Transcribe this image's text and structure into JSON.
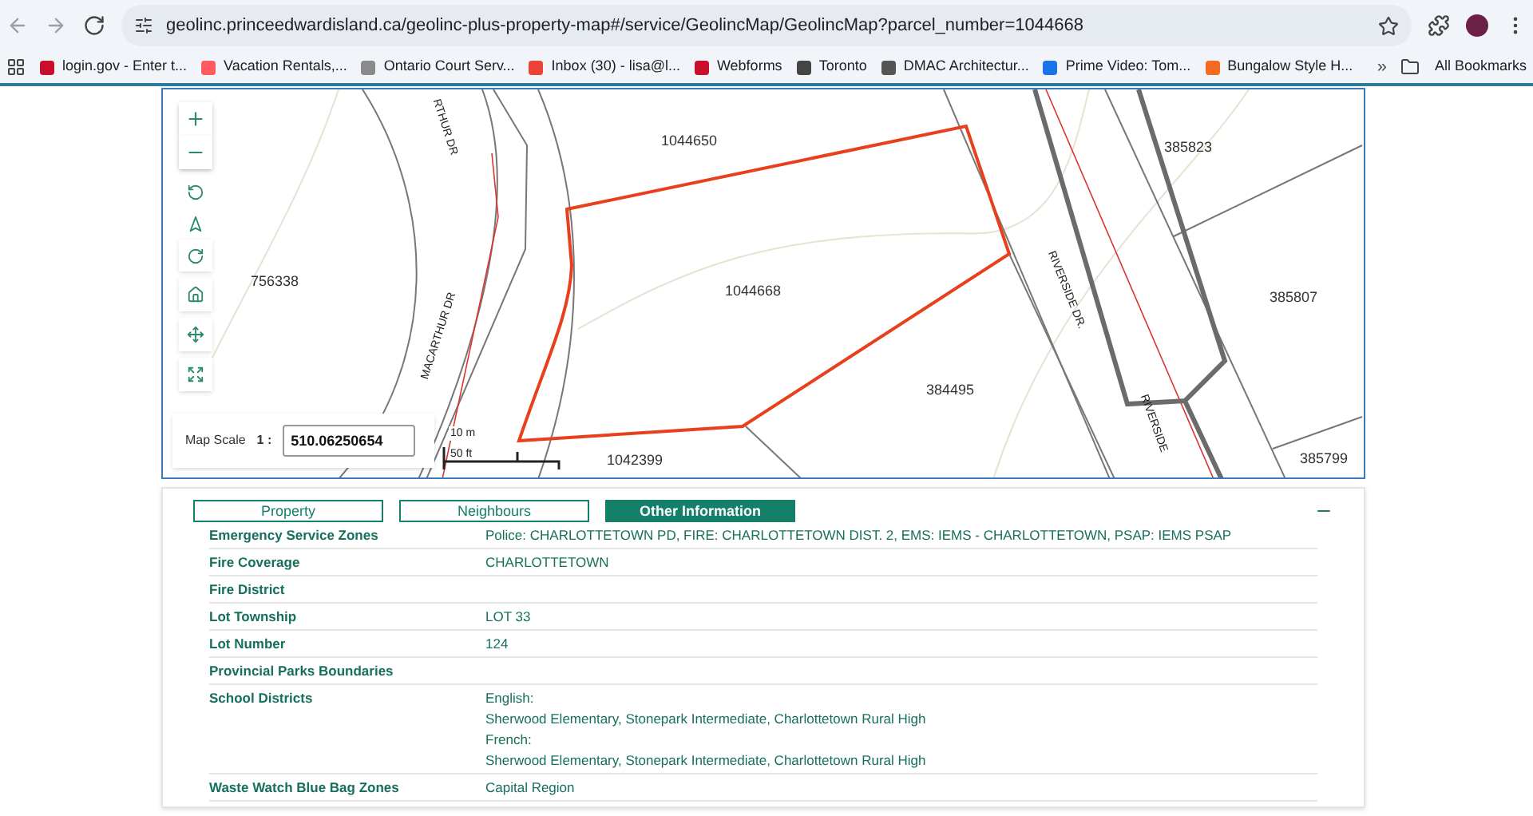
{
  "browser": {
    "url": "geolinc.princeedwardisland.ca/geolinc-plus-property-map#/service/GeolincMap/GeolincMap?parcel_number=1044668",
    "bookmarks": [
      {
        "label": "login.gov - Enter t...",
        "color": "#c8102e"
      },
      {
        "label": "Vacation Rentals,...",
        "color": "#ff5a5f"
      },
      {
        "label": "Ontario Court Serv...",
        "color": "#8a8a8a"
      },
      {
        "label": "Inbox (30) - lisa@l...",
        "color": "#ea4335"
      },
      {
        "label": "Webforms",
        "color": "#c8102e"
      },
      {
        "label": "Toronto",
        "color": "#444444"
      },
      {
        "label": "DMAC Architectur...",
        "color": "#555555"
      },
      {
        "label": "Prime Video: Tom...",
        "color": "#1a73e8"
      },
      {
        "label": "Bungalow Style H...",
        "color": "#f26b21"
      }
    ],
    "more": "»",
    "all_bookmarks": "All Bookmarks"
  },
  "map": {
    "parcels": [
      "1044650",
      "385823",
      "756338",
      "1044668",
      "385807",
      "384495",
      "1042399",
      "385799"
    ],
    "roads": [
      "RTHUR DR",
      "MACARTHUR DR",
      "RIVERSIDE DR.",
      "RIVERSIDE"
    ],
    "scale_label": "Map Scale",
    "scale_ratio": "1 :",
    "scale_value": "510.06250654",
    "scale_bar": [
      "10 m",
      "50 ft"
    ]
  },
  "tabs": [
    {
      "label": "Property",
      "selected": false
    },
    {
      "label": "Neighbours",
      "selected": false
    },
    {
      "label": "Other Information",
      "selected": true
    }
  ],
  "rows": [
    {
      "label": "Emergency Service Zones",
      "values": [
        "Police: CHARLOTTETOWN PD, FIRE: CHARLOTTETOWN DIST. 2, EMS: IEMS - CHARLOTTETOWN, PSAP: IEMS PSAP"
      ]
    },
    {
      "label": "Fire Coverage",
      "values": [
        "CHARLOTTETOWN"
      ]
    },
    {
      "label": "Fire District",
      "values": []
    },
    {
      "label": "Lot Township",
      "values": [
        "LOT 33"
      ]
    },
    {
      "label": "Lot Number",
      "values": [
        "124"
      ]
    },
    {
      "label": "Provincial Parks Boundaries",
      "values": []
    },
    {
      "label": "School Districts",
      "values": [
        "English:",
        "Sherwood Elementary, Stonepark Intermediate, Charlottetown Rural High",
        "French:",
        "Sherwood Elementary, Stonepark Intermediate, Charlottetown Rural High"
      ]
    },
    {
      "label": "Waste Watch Blue Bag Zones",
      "values": [
        "Capital Region"
      ]
    }
  ]
}
